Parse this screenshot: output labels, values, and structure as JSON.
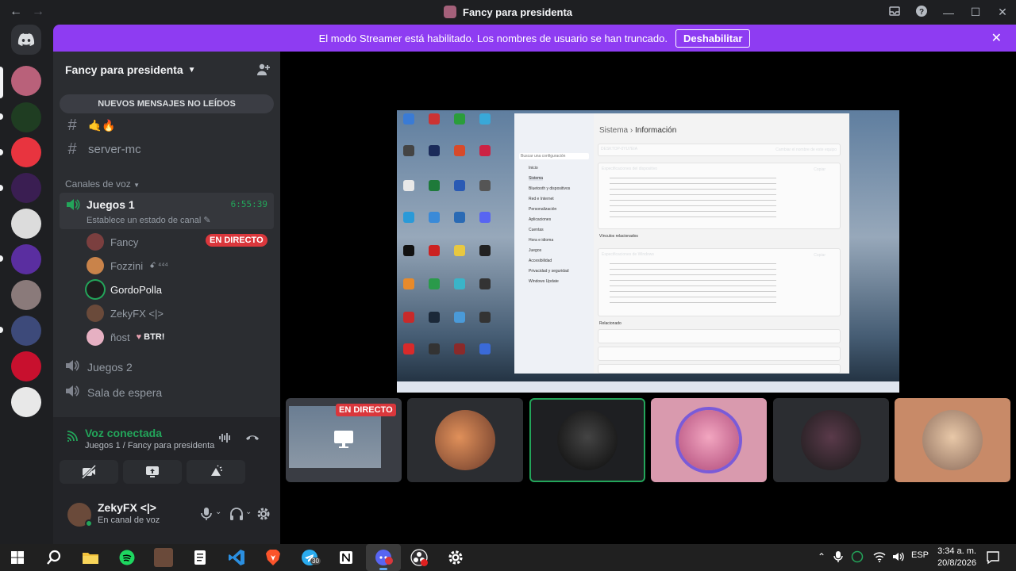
{
  "window": {
    "title": "Fancy para presidenta",
    "back": "←",
    "forward": "→",
    "controls": [
      "—",
      "☐",
      "✕"
    ]
  },
  "banner": {
    "message": "El modo Streamer está habilitado. Los nombres de usuario se han truncado.",
    "button": "Deshabilitar"
  },
  "guild": {
    "name": "Fancy para presidenta",
    "unread_pill": "NUEVOS MENSAJES NO LEÍDOS",
    "text_channels": [
      {
        "name": "🤙🔥"
      },
      {
        "name": "server-mc"
      }
    ],
    "voice_category": "Canales de voz",
    "active_voice": {
      "name": "Juegos 1",
      "timer": "6:55:39",
      "status": "Establece un estado de canal"
    },
    "voice_users": [
      {
        "name": "Fancy",
        "color": "#7b3f3f"
      },
      {
        "name": "Fozzini",
        "suffix": "ꗃ ⁴⁴⁴",
        "color": "#c9834a"
      },
      {
        "name": "GordoPolla",
        "color": "#1d1d1d"
      },
      {
        "name": "ZekyFX <|>",
        "color": "#6a4a3a"
      },
      {
        "name": "ñost",
        "tag": "BTR!",
        "color": "#e6b0c2"
      }
    ],
    "live_badge": "EN DIRECTO",
    "other_voice": [
      "Juegos 2",
      "Sala de espera"
    ]
  },
  "voice_panel": {
    "title": "Voz conectada",
    "subtitle": "Juegos 1 / Fancy para presidenta"
  },
  "user": {
    "name": "ZekyFX <|>",
    "status": "En canal de voz"
  },
  "stream": {
    "breadcrumb_parent": "Sistema",
    "breadcrumb_current": "Información",
    "device_name": "DESKTOP-0YU7EIA",
    "rename_button": "Cambiar el nombre de este equipo",
    "card1_title": "Especificaciones del dispositivo",
    "card2_title": "Especificaciones de Windows",
    "copy": "Copiar",
    "related_links": "Vínculos relacionados",
    "related": "Relacionado",
    "sidebar_items": [
      "Inicio",
      "Sistema",
      "Bluetooth y dispositivos",
      "Red e Internet",
      "Personalización",
      "Aplicaciones",
      "Cuentas",
      "Hora e idioma",
      "Juegos",
      "Accesibilidad",
      "Privacidad y seguridad",
      "Windows Update"
    ],
    "search_placeholder": "Buscar una configuración"
  },
  "thumbnails": {
    "live_badge": "EN DIRECTO"
  },
  "taskbar": {
    "lang": "ESP",
    "time": "3:34 a. m.",
    "date": "20/8/2026",
    "badge": "30"
  }
}
